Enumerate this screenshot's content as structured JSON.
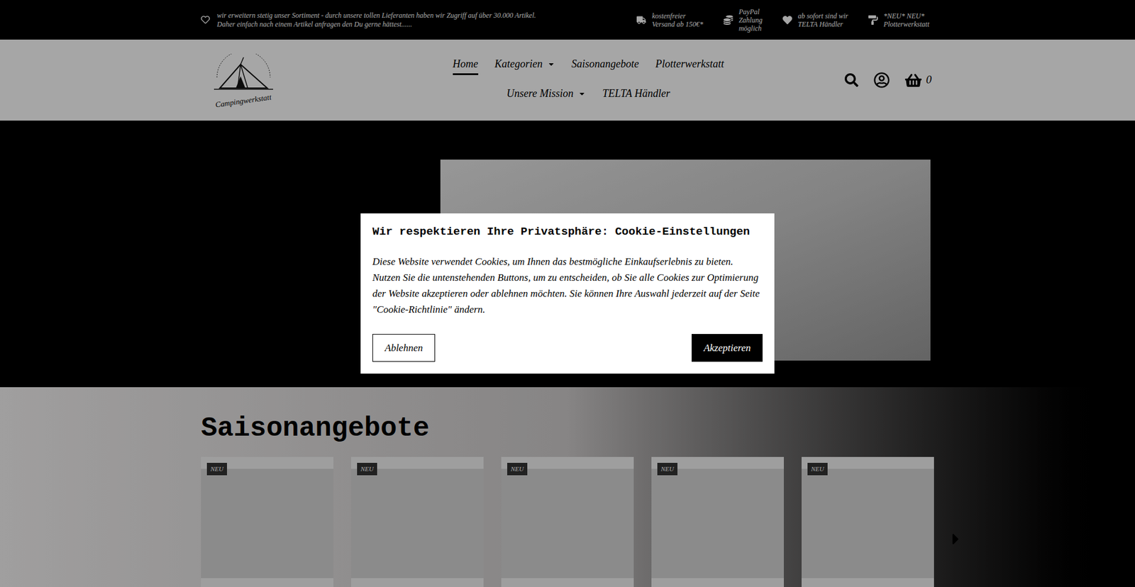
{
  "top_bar": {
    "notice_lines": [
      "wir erweitern stetig unser Sortiment - durch unsere tollen Lieferanten haben wir Zugriff auf über 30.000 Artikel.",
      "Daher einfach nach einem Artikel anfragen den Du gerne hättest......"
    ],
    "features": [
      {
        "kind": "truck",
        "lines": [
          "kostenfreier",
          "Versand ab 150€*"
        ]
      },
      {
        "kind": "coins",
        "lines": [
          "PayPal",
          "Zahlung",
          "möglich"
        ]
      },
      {
        "kind": "heart",
        "lines": [
          "ab sofort sind wir",
          "TELTA Händler"
        ]
      },
      {
        "kind": "roller",
        "lines": [
          "*NEU* NEU*",
          "Plotterwerkstatt"
        ]
      }
    ]
  },
  "header": {
    "logo_text": "Campingwerkstatt",
    "nav_rows": [
      [
        {
          "label": "Home",
          "selected": true,
          "has_dropdown": false
        },
        {
          "label": "Kategorien",
          "selected": false,
          "has_dropdown": true
        },
        {
          "label": "Saisonangebote",
          "selected": false,
          "has_dropdown": false
        },
        {
          "label": "Plotterwerkstatt",
          "selected": false,
          "has_dropdown": false
        }
      ],
      [
        {
          "label": "Unsere Mission",
          "selected": false,
          "has_dropdown": true
        },
        {
          "label": "TELTA Händler",
          "selected": false,
          "has_dropdown": false
        }
      ]
    ],
    "cart_count": "0"
  },
  "offers": {
    "title": "Saisonangebote",
    "products": [
      {
        "badge": "NEU"
      },
      {
        "badge": "NEU"
      },
      {
        "badge": "NEU"
      },
      {
        "badge": "NEU"
      },
      {
        "badge": "NEU"
      }
    ]
  },
  "cookie_dialog": {
    "title": "Wir respektieren Ihre Privatsphäre: Cookie-Einstellungen",
    "body": "Diese Website verwendet Cookies, um Ihnen das bestmögliche Einkaufserlebnis zu bieten. Nutzen Sie die untenstehenden Buttons, um zu entscheiden, ob Sie alle Cookies zur Optimierung der Website akzeptieren oder ablehnen möchten. Sie können Ihre Auswahl jederzeit auf der Seite \"Cookie-Richtlinie\" ändern.",
    "decline": "Ablehnen",
    "accept": "Akzeptieren"
  }
}
